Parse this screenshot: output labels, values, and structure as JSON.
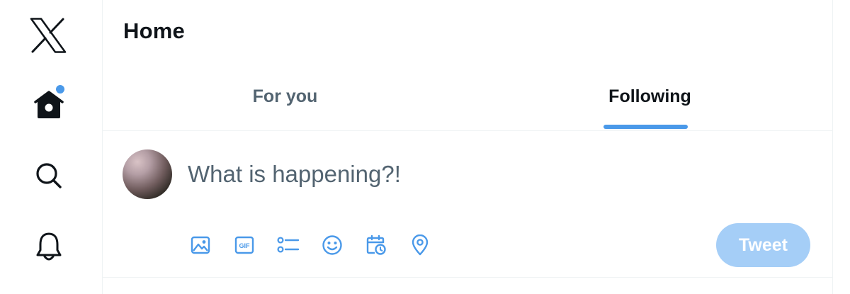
{
  "sidebar": {
    "items": [
      {
        "icon": "x-logo-icon"
      },
      {
        "icon": "home-icon",
        "has_notification": true
      },
      {
        "icon": "search-icon"
      },
      {
        "icon": "bell-icon"
      }
    ]
  },
  "header": {
    "title": "Home"
  },
  "tabs": [
    {
      "label": "For you",
      "active": false
    },
    {
      "label": "Following",
      "active": true
    }
  ],
  "composer": {
    "placeholder": "What is happening?!",
    "tools": [
      "image-icon",
      "gif-icon",
      "poll-icon",
      "emoji-icon",
      "schedule-icon",
      "location-icon"
    ],
    "submit_label": "Tweet"
  },
  "colors": {
    "accent": "#4a99e9",
    "tweet_button_disabled": "#a5cef7",
    "text_primary": "#0f1419",
    "text_secondary": "#536471",
    "divider": "#eff3f4"
  }
}
